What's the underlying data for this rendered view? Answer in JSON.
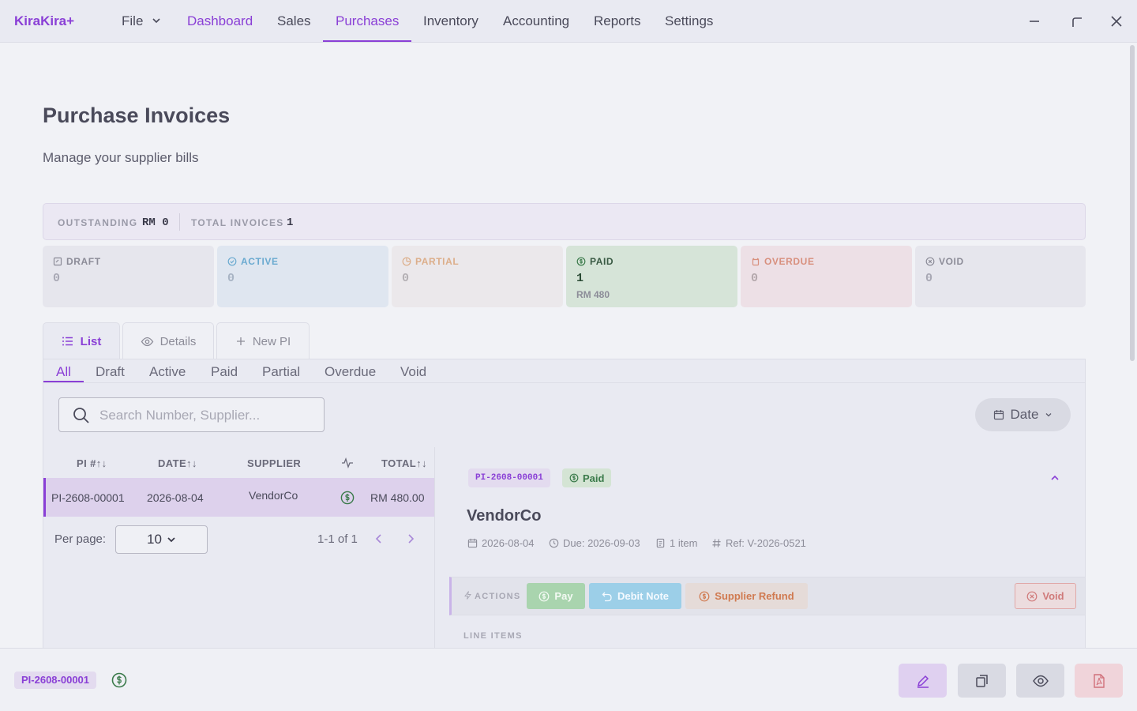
{
  "app": {
    "name": "KiraKira+"
  },
  "nav": {
    "file": "File",
    "items": [
      "Dashboard",
      "Sales",
      "Purchases",
      "Inventory",
      "Accounting",
      "Reports",
      "Settings"
    ]
  },
  "page": {
    "title": "Purchase Invoices",
    "subtitle": "Manage your supplier bills"
  },
  "summary": {
    "outstanding_label": "OUTSTANDING",
    "outstanding_value": "RM 0",
    "total_label": "TOTAL INVOICES",
    "total_value": "1"
  },
  "status_cards": [
    {
      "label": "DRAFT",
      "count": "0",
      "amount": "",
      "color": "#8c8c98"
    },
    {
      "label": "ACTIVE",
      "count": "0",
      "amount": "",
      "color": "#5aa0c8"
    },
    {
      "label": "PARTIAL",
      "count": "0",
      "amount": "",
      "color": "#d4a070"
    },
    {
      "label": "PAID",
      "count": "1",
      "amount": "RM 480",
      "color": "#3a7a4a"
    },
    {
      "label": "OVERDUE",
      "count": "0",
      "amount": "",
      "color": "#d07a6a"
    },
    {
      "label": "VOID",
      "count": "0",
      "amount": "",
      "color": "#8c8c98"
    }
  ],
  "view_tabs": {
    "list": "List",
    "details": "Details",
    "new": "New PI"
  },
  "filter_tabs": [
    "All",
    "Draft",
    "Active",
    "Paid",
    "Partial",
    "Overdue",
    "Void"
  ],
  "search": {
    "placeholder": "Search Number, Supplier..."
  },
  "date_button": "Date",
  "table": {
    "headers": {
      "pi": "PI #↑↓",
      "date": "DATE↑↓",
      "supplier": "SUPPLIER",
      "total": "TOTAL↑↓"
    },
    "rows": [
      {
        "pi": "PI-2608-00001",
        "date": "2026-08-04",
        "supplier": "VendorCo",
        "total": "RM 480.00"
      }
    ]
  },
  "pagination": {
    "per_page_label": "Per page:",
    "per_page_value": "10",
    "range": "1-1 of 1"
  },
  "detail": {
    "code": "PI-2608-00001",
    "status": "Paid",
    "supplier": "VendorCo",
    "date": "2026-08-04",
    "due": "Due: 2026-09-03",
    "items": "1 item",
    "ref": "Ref: V-2026-0521",
    "actions_label": "ACTIONS",
    "actions": {
      "pay": "Pay",
      "debit": "Debit Note",
      "refund": "Supplier Refund",
      "void": "Void"
    },
    "line_items_label": "LINE ITEMS"
  },
  "footer": {
    "code": "PI-2608-00001"
  },
  "colors": {
    "accent": "#8a3fd6",
    "paid": "#3a7a4a"
  }
}
